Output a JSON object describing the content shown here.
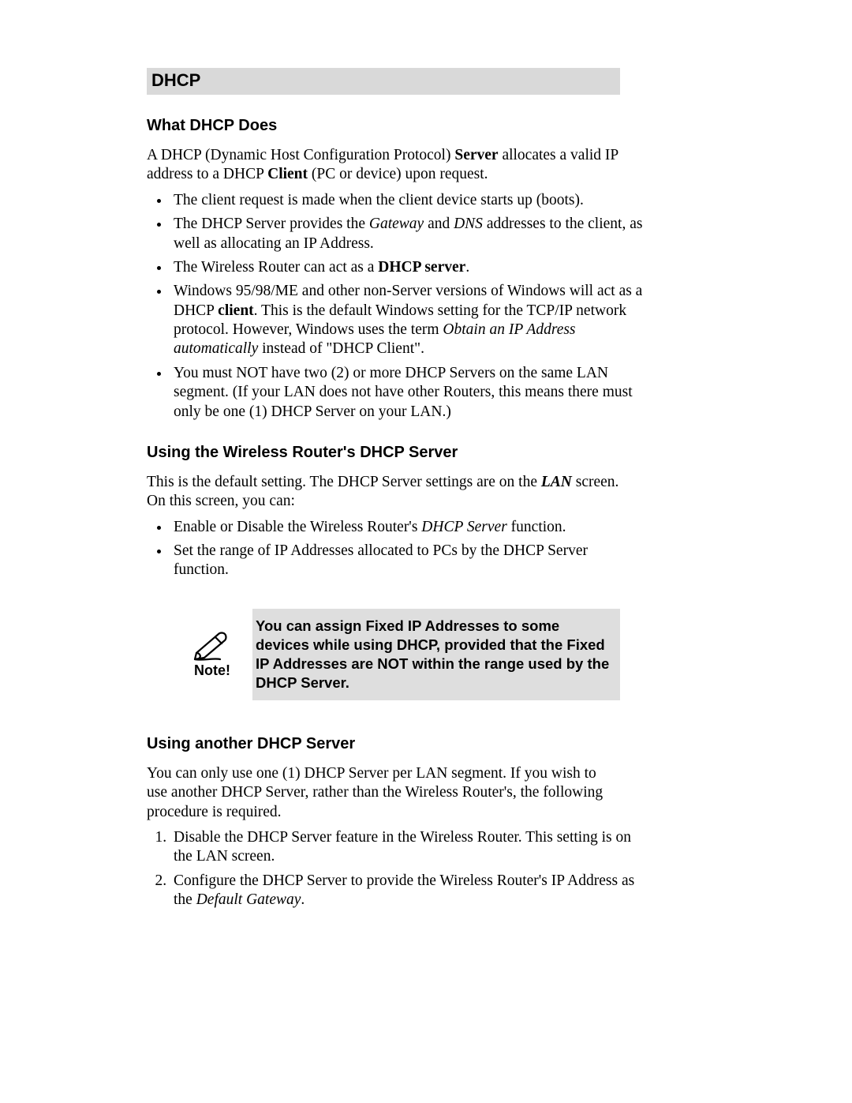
{
  "section_title": "DHCP",
  "what_dhcp": {
    "heading": "What DHCP Does",
    "intro_pre": "A DHCP (Dynamic Host Configuration Protocol) ",
    "intro_server": "Server",
    "intro_mid": " allocates a valid IP address to a DHCP ",
    "intro_client": "Client",
    "intro_post": " (PC or device) upon request.",
    "bullets": {
      "b1": "The client request is made when the client device starts up (boots).",
      "b2_pre": "The DHCP Server provides the ",
      "b2_gateway": "Gateway",
      "b2_and": " and ",
      "b2_dns": "DNS",
      "b2_post": " addresses to the client, as well as allocating an IP Address.",
      "b3_pre": "The Wireless Router can act as a ",
      "b3_bold": "DHCP server",
      "b3_post": ".",
      "b4_pre": "Windows 95/98/ME and other non-Server versions of Windows will act as a DHCP ",
      "b4_client": "client",
      "b4_mid": ". This is the default Windows setting for the TCP/IP network protocol. However, Windows uses the term ",
      "b4_ital": "Obtain an IP Address automatically",
      "b4_post": " instead of \"DHCP Client\".",
      "b5": "You must NOT have two (2) or more DHCP Servers on the same LAN segment. (If your LAN does not have other Routers, this means there must only be one (1) DHCP Server on your LAN.)"
    }
  },
  "using_router": {
    "heading": "Using the Wireless Router's DHCP Server",
    "intro_pre": "This is the default setting. The DHCP Server settings are on the ",
    "intro_lan": "LAN",
    "intro_post": " screen. On this screen, you can:",
    "bullets": {
      "b1_pre": "Enable or Disable the Wireless Router's ",
      "b1_ital": "DHCP Server",
      "b1_post": " function.",
      "b2": "Set the range of IP Addresses allocated to PCs by the DHCP Server function."
    }
  },
  "note": {
    "label": "Note!",
    "text": "You can assign Fixed IP Addresses to some devices while using DHCP, provided that the Fixed IP Addresses are NOT within the range used by the DHCP Server."
  },
  "using_another": {
    "heading": "Using another DHCP Server",
    "intro": "You can only use one (1) DHCP Server per LAN segment. If you wish to use another DHCP Server, rather than the Wireless Router's, the following procedure is required.",
    "steps": {
      "s1": "Disable the DHCP Server feature in the Wireless Router. This setting is on the LAN screen.",
      "s2_pre": "Configure the DHCP Server to provide the Wireless Router's IP Address as the ",
      "s2_ital": "Default Gateway",
      "s2_post": "."
    }
  }
}
